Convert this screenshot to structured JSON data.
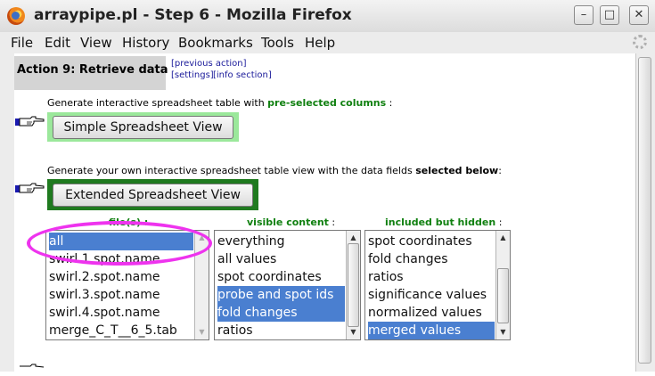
{
  "window": {
    "title": "arraypipe.pl - Step 6 - Mozilla Firefox",
    "minimize": "–",
    "maximize": "□",
    "close": "✕"
  },
  "menu": [
    "File",
    "Edit",
    "View",
    "History",
    "Bookmarks",
    "Tools",
    "Help"
  ],
  "action": {
    "title": "Action 9: Retrieve data",
    "previous_link": "[previous action]",
    "settings_link": "[settings]",
    "info_link": "[info section]"
  },
  "simple": {
    "desc_prefix": "Generate interactive spreadsheet table with ",
    "desc_highlight": "pre-selected columns",
    "desc_suffix": " :",
    "button_label": "Simple Spreadsheet View"
  },
  "extended": {
    "desc_prefix": "Generate your own interactive spreadsheet table view with the data fields ",
    "desc_bold": "selected below",
    "desc_suffix": ":",
    "button_label": "Extended Spreadsheet View"
  },
  "columns": {
    "files_header": "file(s) :",
    "visible_header": "visible content",
    "visible_suffix": " :",
    "hidden_header": "included but hidden",
    "hidden_suffix": " :"
  },
  "files_list": [
    {
      "label": "all",
      "selected": true
    },
    {
      "label": "swirl.1.spot.name",
      "selected": false
    },
    {
      "label": "swirl.2.spot.name",
      "selected": false
    },
    {
      "label": "swirl.3.spot.name",
      "selected": false
    },
    {
      "label": "swirl.4.spot.name",
      "selected": false
    },
    {
      "label": "merge_C_T__6_5.tab",
      "selected": false
    }
  ],
  "visible_list": [
    {
      "label": "everything",
      "selected": false
    },
    {
      "label": "all values",
      "selected": false
    },
    {
      "label": "spot coordinates",
      "selected": false
    },
    {
      "label": "probe and spot ids",
      "selected": true
    },
    {
      "label": "fold changes",
      "selected": true
    },
    {
      "label": "ratios",
      "selected": false
    }
  ],
  "hidden_list": [
    {
      "label": "spot coordinates",
      "selected": false
    },
    {
      "label": "fold changes",
      "selected": false
    },
    {
      "label": "ratios",
      "selected": false
    },
    {
      "label": "significance values",
      "selected": false
    },
    {
      "label": "normalized values",
      "selected": false
    },
    {
      "label": "merged values",
      "selected": true
    }
  ],
  "colors": {
    "accent_green": "#108010",
    "selection_blue": "#4a7fd0",
    "annotation_magenta": "#ee33ee"
  }
}
